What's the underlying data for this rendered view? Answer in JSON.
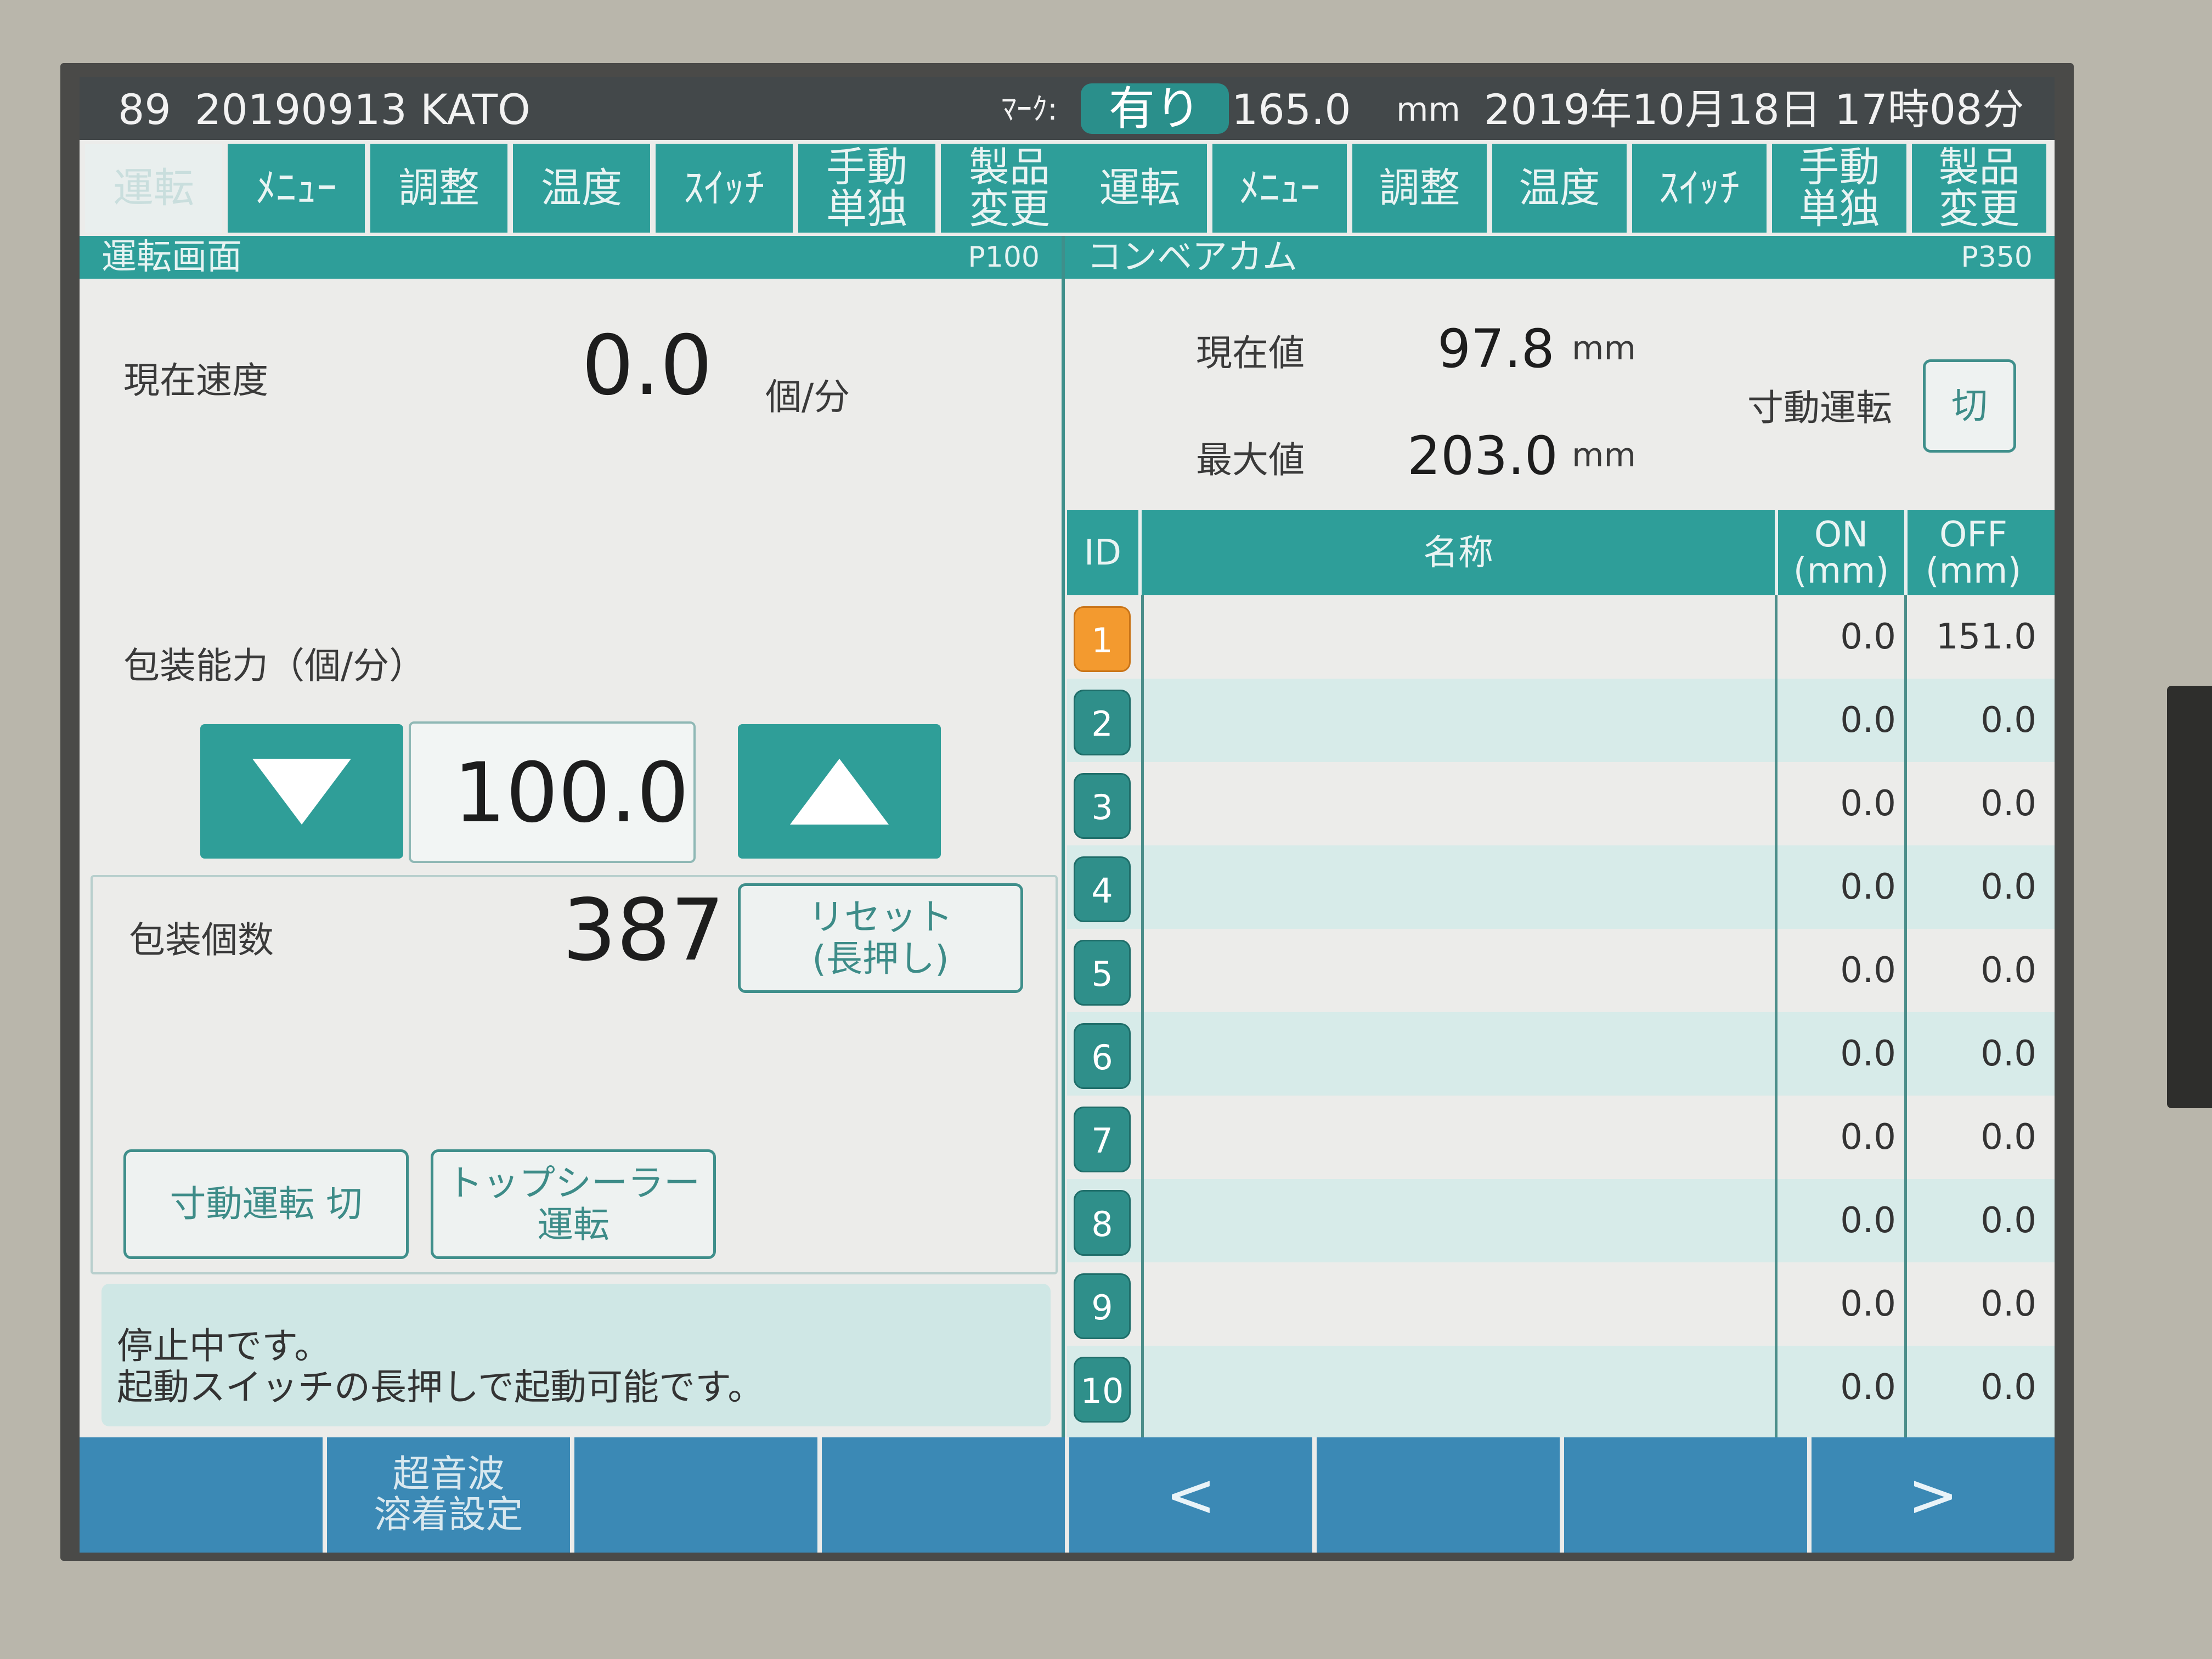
{
  "status_bar": {
    "id_code": "89",
    "recipe": "20190913 KATO",
    "mark_label": "ﾏｰｸ:",
    "mark_value": "有り",
    "length_value": "165.0",
    "length_unit": "mm",
    "datetime": "2019年10月18日 17時08分"
  },
  "tabs_left": [
    {
      "label": "運転"
    },
    {
      "label": "ﾒﾆｭｰ"
    },
    {
      "label": "調整"
    },
    {
      "label": "温度"
    },
    {
      "label": "ｽｲｯﾁ"
    },
    {
      "label": "手動\n単独"
    },
    {
      "label": "製品\n変更"
    }
  ],
  "tabs_right": [
    {
      "label": "運転"
    },
    {
      "label": "ﾒﾆｭｰ"
    },
    {
      "label": "調整"
    },
    {
      "label": "温度"
    },
    {
      "label": "ｽｲｯﾁ"
    },
    {
      "label": "手動\n単独"
    },
    {
      "label": "製品\n変更"
    }
  ],
  "left_panel": {
    "title": "運転画面",
    "code": "P100",
    "current_speed_label": "現在速度",
    "current_speed_value": "0.0",
    "current_speed_unit": "個/分",
    "capacity_label": "包装能力（個/分）",
    "capacity_value": "100.0",
    "count_label": "包装個数",
    "count_value": "387",
    "reset_button_line1": "リセット",
    "reset_button_line2": "(長押し)",
    "jog_button": "寸動運転 切",
    "top_sealer_line1": "トップシーラー",
    "top_sealer_line2": "運転",
    "message_line1": "停止中です。",
    "message_line2": "起動スイッチの長押しで起動可能です。"
  },
  "right_panel": {
    "title": "コンベアカム",
    "code": "P350",
    "current_label": "現在値",
    "current_value": "97.8",
    "current_unit": "mm",
    "max_label": "最大値",
    "max_value": "203.0",
    "max_unit": "mm",
    "jog_label": "寸動運転",
    "jog_button": "切",
    "table": {
      "col_id": "ID",
      "col_name": "名称",
      "col_on": "ON\n(mm)",
      "col_off": "OFF\n(mm)",
      "rows": [
        {
          "id": "1",
          "name": "",
          "on": "0.0",
          "off": "151.0"
        },
        {
          "id": "2",
          "name": "",
          "on": "0.0",
          "off": "0.0"
        },
        {
          "id": "3",
          "name": "",
          "on": "0.0",
          "off": "0.0"
        },
        {
          "id": "4",
          "name": "",
          "on": "0.0",
          "off": "0.0"
        },
        {
          "id": "5",
          "name": "",
          "on": "0.0",
          "off": "0.0"
        },
        {
          "id": "6",
          "name": "",
          "on": "0.0",
          "off": "0.0"
        },
        {
          "id": "7",
          "name": "",
          "on": "0.0",
          "off": "0.0"
        },
        {
          "id": "8",
          "name": "",
          "on": "0.0",
          "off": "0.0"
        },
        {
          "id": "9",
          "name": "",
          "on": "0.0",
          "off": "0.0"
        },
        {
          "id": "10",
          "name": "",
          "on": "0.0",
          "off": "0.0"
        }
      ]
    }
  },
  "bottom_bar": [
    {
      "label": ""
    },
    {
      "label": "超音波\n溶着設定"
    },
    {
      "label": ""
    },
    {
      "label": ""
    },
    {
      "label": "<"
    },
    {
      "label": ""
    },
    {
      "label": ""
    },
    {
      "label": ">"
    }
  ],
  "colors": {
    "teal": "#2e9e99",
    "highlight_orange": "#f39a2f",
    "bottom_blue": "#3b89b5"
  }
}
